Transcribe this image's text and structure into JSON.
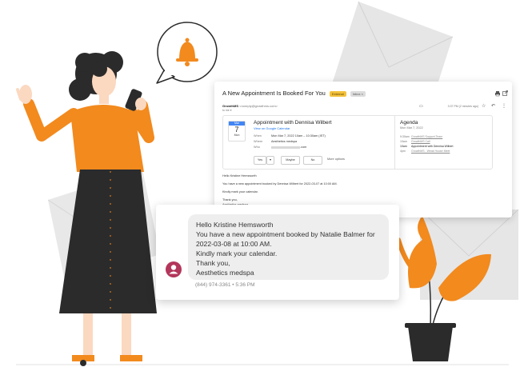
{
  "colors": {
    "accent_orange": "#f28a1e",
    "skirt": "#2b2b2b",
    "avatar": "#b3365b",
    "calendar_blue": "#4285f4",
    "link_blue": "#1a73e8"
  },
  "email": {
    "subject": "A New Appointment Is Booked For You",
    "tag_external": "External",
    "tag_inbox": "Inbox ×",
    "print_icon": "printer-icon",
    "open_icon": "open-in-new-icon",
    "sender": "GrowthMS",
    "sender_address": "<noreply@growthms.com>",
    "to": "to me ▾",
    "time": "3:37 PM (2 minutes ago)",
    "invite": {
      "cal_month": "Mar",
      "cal_day": "7",
      "cal_weekday": "Mon",
      "title": "Appointment with Dennisa Wilbert",
      "view_link": "View on Google Calendar",
      "when_label": "When",
      "when_value": "Mon Mar 7, 2022 10am – 10:30am (IST)",
      "where_label": "Where",
      "where_value": "Aesthetics medspa",
      "who_label": "Who",
      "who_value": ".com",
      "btn_yes": "Yes",
      "btn_maybe": "Maybe",
      "btn_no": "No",
      "more_options": "More options"
    },
    "agenda": {
      "title": "Agenda",
      "date": "Mon Mar 7, 2022",
      "items": [
        {
          "time": "9:30am",
          "event": "GrowthMS Support Team",
          "bold": false
        },
        {
          "time": "10am",
          "event": "GrowthMS Call",
          "bold": false
        },
        {
          "time": "10am",
          "event": "Appointment with Dennisa Wilbert",
          "bold": true
        },
        {
          "time": "4pm",
          "event": "GrowthMS - Weak House Meet",
          "bold": false
        }
      ]
    },
    "body": [
      "Hello Kristine Hemsworth",
      "You have a new appointment booked by Dennisa Wilbert for 2022-03-07 at 10:00 AM.",
      "Kindly mark your calendar.",
      "Thank you,",
      "Aesthetics medspa"
    ]
  },
  "sms": {
    "lines": [
      "Hello Kristine Hemsworth",
      "You have a new appointment booked by Natalie Balmer for",
      "2022-03-08 at 10:00 AM.",
      "Kindly mark your calendar.",
      "Thank you,",
      "Aesthetics medspa"
    ],
    "meta": "(844) 974-3361 • 5:36 PM"
  }
}
